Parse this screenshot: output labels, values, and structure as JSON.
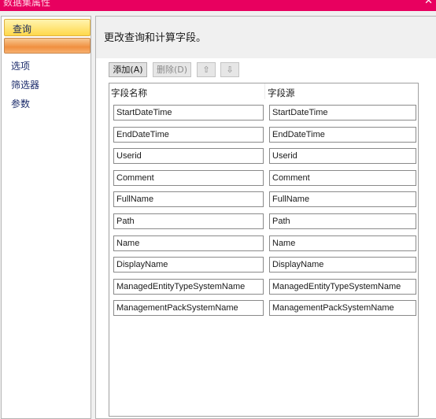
{
  "window": {
    "title": "数据集属性",
    "close_glyph": "✕"
  },
  "sidebar": {
    "items": [
      {
        "label": "查询",
        "selected": true
      },
      {
        "label": "",
        "hover": true
      },
      {
        "label": "选项"
      },
      {
        "label": "筛选器"
      },
      {
        "label": "参数"
      }
    ]
  },
  "main": {
    "heading": "更改查询和计算字段。",
    "toolbar": {
      "add_label": "添加(A)",
      "delete_label": "删除(D)",
      "move_up_icon": "arrow-up-icon",
      "move_down_icon": "arrow-down-icon",
      "up_glyph": "⇧",
      "down_glyph": "⇩"
    },
    "grid": {
      "columns": [
        "字段名称",
        "字段源"
      ],
      "rows": [
        [
          "StartDateTime",
          "StartDateTime"
        ],
        [
          "EndDateTime",
          "EndDateTime"
        ],
        [
          "Userid",
          "Userid"
        ],
        [
          "Comment",
          "Comment"
        ],
        [
          "FullName",
          "FullName"
        ],
        [
          "Path",
          "Path"
        ],
        [
          "Name",
          "Name"
        ],
        [
          "DisplayName",
          "DisplayName"
        ],
        [
          "ManagedEntityTypeSystemName",
          "ManagedEntityTypeSystemName"
        ],
        [
          "ManagementPackSystemName",
          "ManagementPackSystemName"
        ]
      ]
    }
  },
  "colors": {
    "titlebar": "#e8005f",
    "nav_selected": "#ffd84a",
    "nav_hover": "#f09040"
  }
}
